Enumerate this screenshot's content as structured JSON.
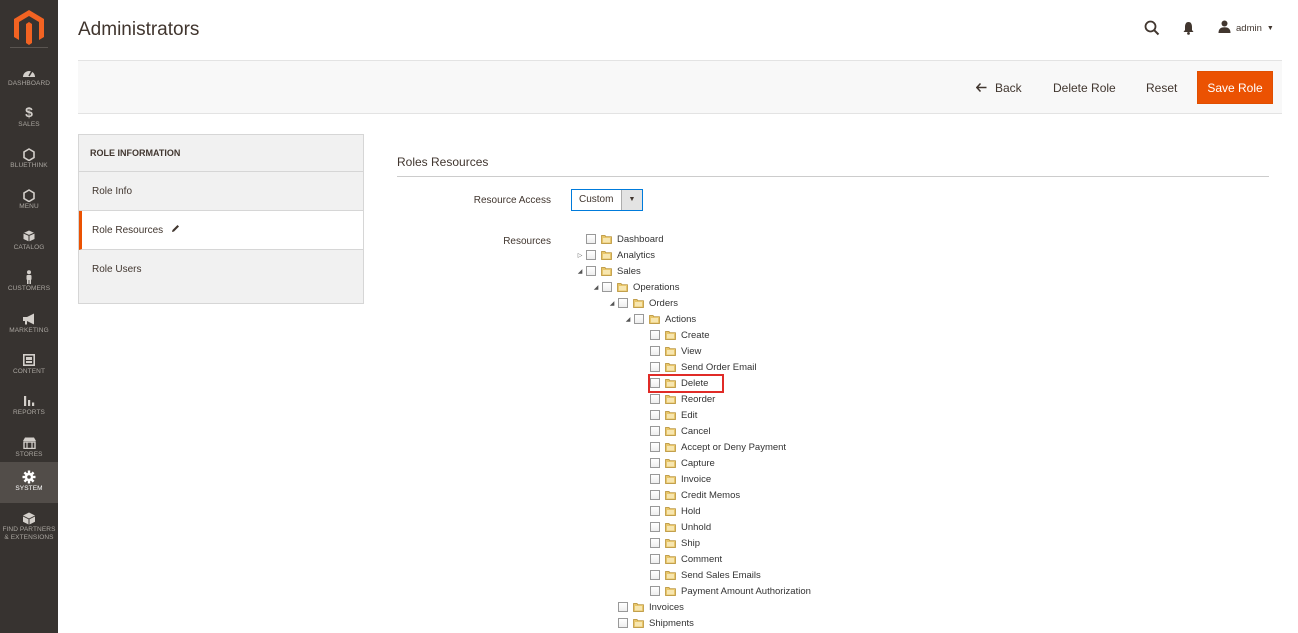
{
  "sidebar": {
    "logo": "magento-logo-icon",
    "items": [
      {
        "label": "DASHBOARD",
        "icon": "dashboard-icon"
      },
      {
        "label": "SALES",
        "icon": "dollar-icon"
      },
      {
        "label": "BLUETHINK",
        "icon": "hexagon-icon"
      },
      {
        "label": "MENU",
        "icon": "hexagon-icon"
      },
      {
        "label": "CATALOG",
        "icon": "box-icon"
      },
      {
        "label": "CUSTOMERS",
        "icon": "person-icon"
      },
      {
        "label": "MARKETING",
        "icon": "megaphone-icon"
      },
      {
        "label": "CONTENT",
        "icon": "layout-icon"
      },
      {
        "label": "REPORTS",
        "icon": "bar-chart-icon"
      },
      {
        "label": "STORES",
        "icon": "store-icon"
      },
      {
        "label": "SYSTEM",
        "icon": "gear-icon"
      },
      {
        "label": "FIND PARTNERS & EXTENSIONS",
        "icon": "cubes-icon"
      }
    ],
    "active": "SYSTEM"
  },
  "header": {
    "title": "Administrators",
    "user": "admin"
  },
  "actions": {
    "back": "Back",
    "delete": "Delete Role",
    "reset": "Reset",
    "save": "Save Role"
  },
  "tabs": {
    "title": "ROLE INFORMATION",
    "items": [
      "Role Info",
      "Role Resources",
      "Role Users"
    ],
    "active": "Role Resources"
  },
  "main": {
    "section_title": "Roles Resources",
    "resource_access_label": "Resource Access",
    "resource_access_value": "Custom",
    "resources_label": "Resources"
  },
  "tree": [
    {
      "label": "Dashboard",
      "depth": 0,
      "toggle": "none"
    },
    {
      "label": "Analytics",
      "depth": 0,
      "toggle": "closed"
    },
    {
      "label": "Sales",
      "depth": 0,
      "toggle": "open"
    },
    {
      "label": "Operations",
      "depth": 1,
      "toggle": "open"
    },
    {
      "label": "Orders",
      "depth": 2,
      "toggle": "open"
    },
    {
      "label": "Actions",
      "depth": 3,
      "toggle": "open"
    },
    {
      "label": "Create",
      "depth": 4,
      "toggle": "none"
    },
    {
      "label": "View",
      "depth": 4,
      "toggle": "none"
    },
    {
      "label": "Send Order Email",
      "depth": 4,
      "toggle": "none"
    },
    {
      "label": "Delete",
      "depth": 4,
      "toggle": "none",
      "highlighted": true
    },
    {
      "label": "Reorder",
      "depth": 4,
      "toggle": "none"
    },
    {
      "label": "Edit",
      "depth": 4,
      "toggle": "none"
    },
    {
      "label": "Cancel",
      "depth": 4,
      "toggle": "none"
    },
    {
      "label": "Accept or Deny Payment",
      "depth": 4,
      "toggle": "none"
    },
    {
      "label": "Capture",
      "depth": 4,
      "toggle": "none"
    },
    {
      "label": "Invoice",
      "depth": 4,
      "toggle": "none"
    },
    {
      "label": "Credit Memos",
      "depth": 4,
      "toggle": "none"
    },
    {
      "label": "Hold",
      "depth": 4,
      "toggle": "none"
    },
    {
      "label": "Unhold",
      "depth": 4,
      "toggle": "none"
    },
    {
      "label": "Ship",
      "depth": 4,
      "toggle": "none"
    },
    {
      "label": "Comment",
      "depth": 4,
      "toggle": "none"
    },
    {
      "label": "Send Sales Emails",
      "depth": 4,
      "toggle": "none"
    },
    {
      "label": "Payment Amount Authorization",
      "depth": 4,
      "toggle": "none"
    },
    {
      "label": "Invoices",
      "depth": 2,
      "toggle": "none"
    },
    {
      "label": "Shipments",
      "depth": 2,
      "toggle": "none"
    }
  ],
  "colors": {
    "accent": "#eb5202",
    "sidebar": "#373330",
    "highlight": "#e02b27"
  }
}
